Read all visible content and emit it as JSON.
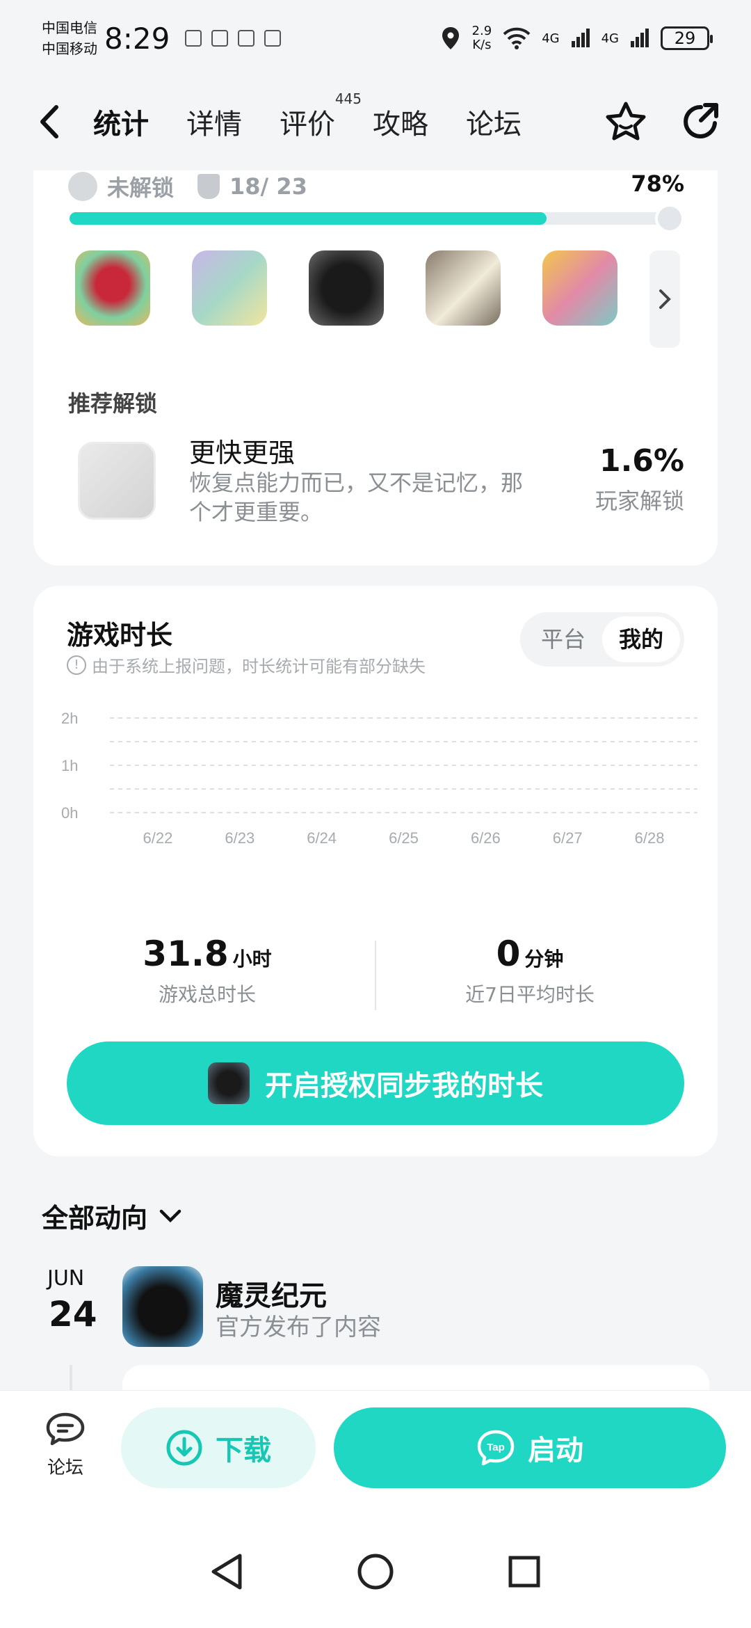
{
  "status_bar": {
    "carrier_1": "中国电信",
    "carrier_2": "中国移动",
    "time": "8:29",
    "net_speed_value": "2.9",
    "net_speed_unit": "K/s",
    "signal_1": "4G",
    "signal_2": "4G",
    "battery": "29"
  },
  "nav": {
    "tabs": [
      {
        "label": "统计"
      },
      {
        "label": "详情"
      },
      {
        "label": "评价",
        "badge": "445"
      },
      {
        "label": "攻略"
      },
      {
        "label": "论坛"
      }
    ]
  },
  "achievements": {
    "lock_label": "未解锁",
    "count": "18/ 23",
    "percent": "78%",
    "progress_fraction": 0.78,
    "recommend_title": "推荐解锁",
    "recommend_name": "更快更强",
    "recommend_desc": "恢复点能力而已，又不是记忆，那个才更重要。",
    "recommend_pct": "1.6%",
    "recommend_pct_label": "玩家解锁",
    "more_icon": "chevron-right-icon"
  },
  "playtime": {
    "title": "游戏时长",
    "note": "由于系统上报问题，时长统计可能有部分缺失",
    "segment": [
      "平台",
      "我的"
    ],
    "selected_segment": "我的",
    "total_value": "31.8",
    "total_unit": "小时",
    "total_label": "游戏总时长",
    "avg_value": "0",
    "avg_unit": "分钟",
    "avg_label": "近7日平均时长",
    "sync_button": "开启授权同步我的时长"
  },
  "chart_data": {
    "type": "bar",
    "categories": [
      "6/22",
      "6/23",
      "6/24",
      "6/25",
      "6/26",
      "6/27",
      "6/28"
    ],
    "values": [
      0,
      0,
      0,
      0,
      0,
      0,
      0
    ],
    "y_ticks": [
      "2h",
      "1h",
      "0h"
    ],
    "ylim": [
      0,
      2
    ],
    "grid": true
  },
  "feed": {
    "title": "全部动向",
    "items": [
      {
        "month": "JUN",
        "day": "24",
        "game": "魔灵纪元",
        "text": "官方发布了内容"
      }
    ]
  },
  "actions": {
    "forum_label": "论坛",
    "download_label": "下载",
    "launch_label": "启动",
    "tap_logo_text": "Tap"
  },
  "colors": {
    "accent": "#1fd7c3",
    "accent_light": "#e4f8f6",
    "muted": "#8a8f94"
  }
}
